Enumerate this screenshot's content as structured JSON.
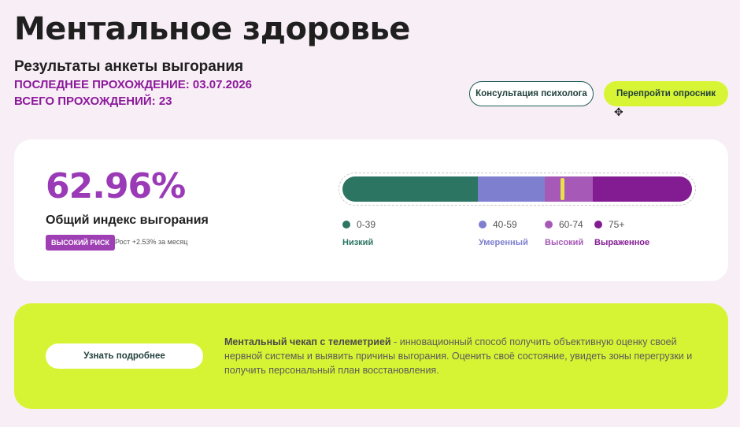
{
  "header": {
    "title": "Ментальное здоровье",
    "subtitle": "Результаты анкеты выгорания",
    "last_pass": "ПОСЛЕДНЕЕ ПРОХОЖДЕНИЕ: 03.07.2026",
    "total_passes": "ВСЕГО ПРОХОЖДЕНИЙ: 23"
  },
  "actions": {
    "consult_label": "Консультация психолога",
    "retake_label": "Перепройти опросник"
  },
  "result": {
    "percent": "62.96%",
    "index_label": "Общий индекс выгорания",
    "risk_badge": "ВЫСОКИЙ РИСК",
    "growth_text": "Рост +2.53% за месяц",
    "value": 62.96
  },
  "scale": {
    "segments": [
      {
        "range": "0-39",
        "name": "Низкий",
        "color": "#2b7562"
      },
      {
        "range": "40-59",
        "name": "Умеренный",
        "color": "#7e7fcf"
      },
      {
        "range": "60-74",
        "name": "Высокий",
        "color": "#a659b6"
      },
      {
        "range": "75+",
        "name": "Выраженное",
        "color": "#831c92"
      }
    ],
    "marker_color": "#e9e14a"
  },
  "cta": {
    "button_label": "Узнать подробнее",
    "text_bold": "Ментальный чекап с телеметрией",
    "text_rest": " - инновационный способ получить объективную оценку своей нервной системы и выявить причины выгорания. Оценить своё состояние, увидеть зоны перегрузки и получить персональный план восстановления."
  },
  "colors": {
    "accent_purple": "#9a3ab6",
    "lime": "#d7f434",
    "background": "#f8eef6"
  }
}
